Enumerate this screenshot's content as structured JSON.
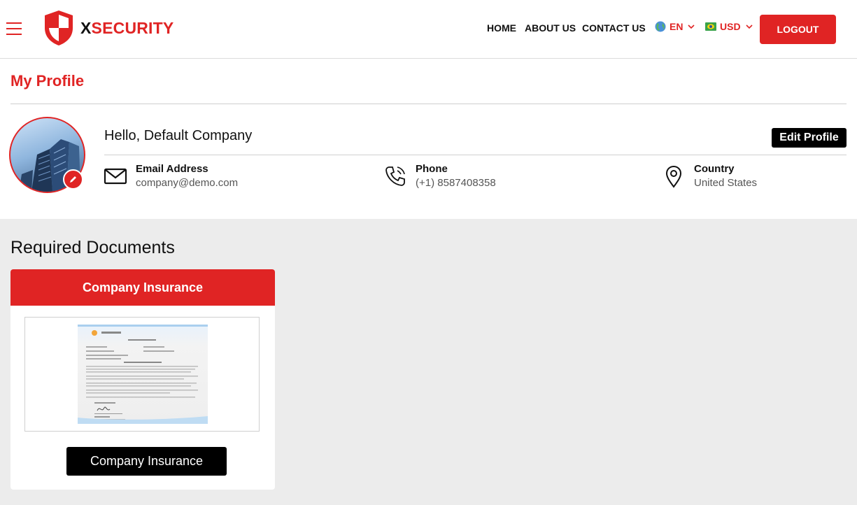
{
  "header": {
    "logo_x": "X",
    "logo_rest": "SECURITY",
    "nav": {
      "home": "HOME",
      "about": "ABOUT US",
      "contact": "CONTACT US"
    },
    "language": "EN",
    "currency": "USD",
    "logout": "LOGOUT"
  },
  "profile": {
    "title": "My Profile",
    "greeting": "Hello, Default Company",
    "edit_button": "Edit Profile",
    "email": {
      "label": "Email Address",
      "value": "company@demo.com"
    },
    "phone": {
      "label": "Phone",
      "value": "(+1) 8587408358"
    },
    "country": {
      "label": "Country",
      "value": "United States"
    }
  },
  "documents": {
    "title": "Required Documents",
    "cards": [
      {
        "header": "Company Insurance",
        "button": "Company Insurance"
      }
    ]
  },
  "colors": {
    "accent": "#e02424",
    "dark": "#000000",
    "background": "#ececec"
  },
  "icons": [
    "hamburger-icon",
    "shield-logo-icon",
    "globe-flag-icon",
    "currency-flag-icon",
    "chevron-down-icon",
    "pencil-icon",
    "envelope-icon",
    "phone-icon",
    "location-pin-icon"
  ]
}
